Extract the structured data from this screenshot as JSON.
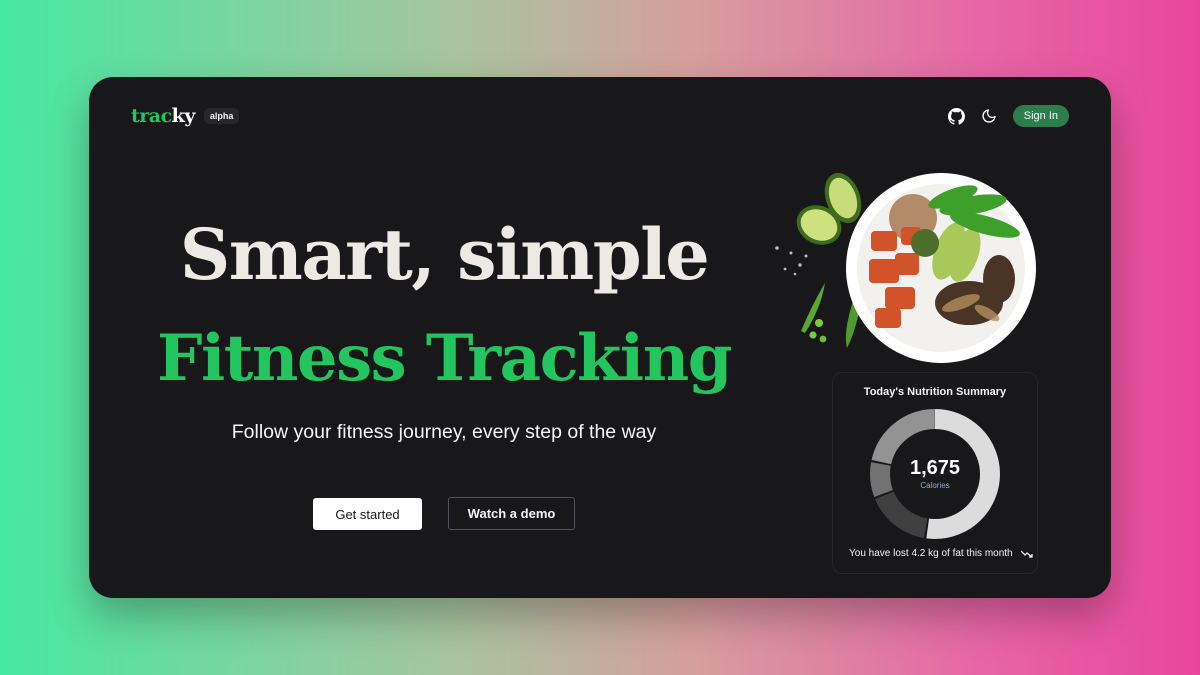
{
  "brand": {
    "logo_green": "trac",
    "logo_white": "ky",
    "badge": "alpha"
  },
  "nav": {
    "github_icon": "github-icon",
    "theme_icon": "moon-icon",
    "signin_label": "Sign In"
  },
  "hero": {
    "line1": "Smart, simple",
    "line2": "Fitness Tracking",
    "tagline": "Follow your fitness journey, every step of the way"
  },
  "actions": {
    "primary": "Get started",
    "secondary": "Watch a demo"
  },
  "summary": {
    "title": "Today's Nutrition Summary",
    "calories": "1,675",
    "calories_label": "Calories",
    "footer": "You have lost 4.2 kg of fat this month",
    "trend_icon": "trending-down-icon"
  },
  "colors": {
    "accent": "#22c55e",
    "signin_bg": "#2e7d4f",
    "window_bg": "#18181b"
  }
}
